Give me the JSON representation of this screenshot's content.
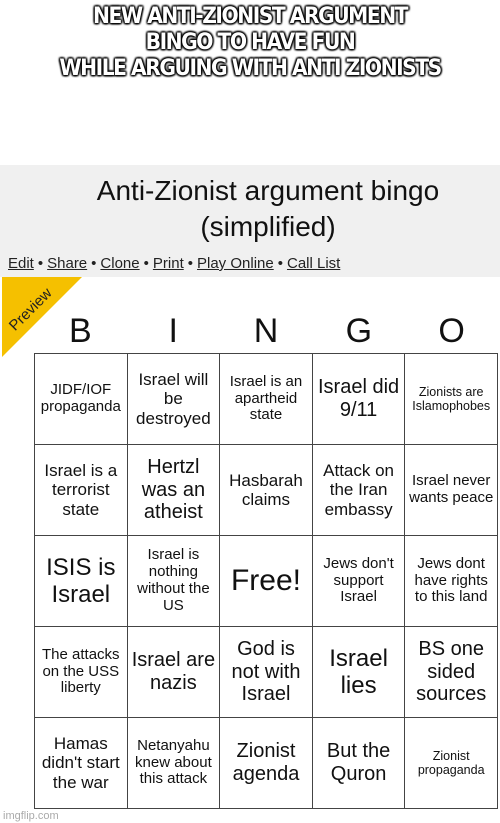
{
  "caption": {
    "lines": [
      "NEW ANTI-ZIONIST ARGUMENT",
      "BINGO TO HAVE FUN",
      "WHILE ARGUING WITH ANTI ZIONISTS"
    ]
  },
  "page": {
    "title_line1": "Anti-Zionist argument bingo",
    "title_line2": "(simplified)",
    "links": [
      "Edit",
      "Share",
      "Clone",
      "Print",
      "Play Online",
      "Call List"
    ],
    "separator": "•",
    "ribbon_label": "Preview",
    "watermark": "imgflip.com"
  },
  "bingo": {
    "header": [
      "B",
      "I",
      "N",
      "G",
      "O"
    ],
    "rows": [
      [
        "JIDF/IOF propaganda",
        "Israel will be destroyed",
        "Israel is an apartheid state",
        "Israel did 9/11",
        "Zionists are Islamophobes"
      ],
      [
        "Israel is a terrorist state",
        "Hertzl was an atheist",
        "Hasbarah claims",
        "Attack on the Iran embassy",
        "Israel never wants peace"
      ],
      [
        "ISIS is Israel",
        "Israel is nothing without the US",
        "Free!",
        "Jews don't support Israel",
        "Jews dont have rights to this land"
      ],
      [
        "The attacks on the USS liberty",
        "Israel are nazis",
        "God is not with Israel",
        "Israel lies",
        "BS one sided sources"
      ],
      [
        "Hamas didn't start the war",
        "Netanyahu knew about this attack",
        "Zionist agenda",
        "But the Quron",
        "Zionist propaganda"
      ]
    ]
  }
}
